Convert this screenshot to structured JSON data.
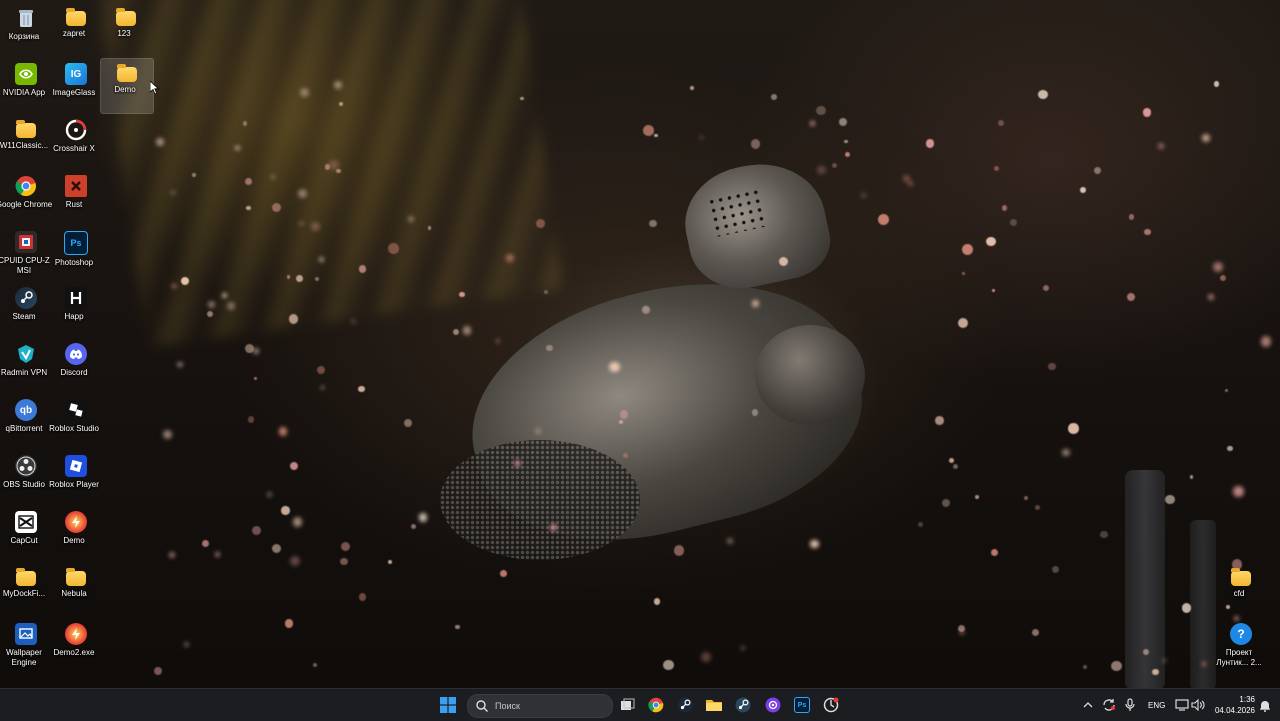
{
  "desktop": {
    "icons": [
      {
        "label": "Корзина",
        "icon": "recycle-bin-icon"
      },
      {
        "label": "zapret",
        "icon": "folder-icon"
      },
      {
        "label": "123",
        "icon": "folder-icon"
      },
      {
        "label": "NVIDIA App",
        "icon": "nvidia-icon"
      },
      {
        "label": "ImageGlass",
        "icon": "imageglass-icon"
      },
      {
        "label": "Demo",
        "icon": "folder-icon"
      },
      {
        "label": "W11Classic...",
        "icon": "folder-icon"
      },
      {
        "label": "Crosshair X",
        "icon": "crosshair-icon"
      },
      {
        "label": "Google Chrome",
        "icon": "chrome-icon"
      },
      {
        "label": "Rust",
        "icon": "rust-icon"
      },
      {
        "label": "CPUID CPU-Z MSI",
        "icon": "cpuz-icon"
      },
      {
        "label": "Photoshop",
        "icon": "photoshop-icon"
      },
      {
        "label": "Steam",
        "icon": "steam-icon"
      },
      {
        "label": "Happ",
        "icon": "happ-icon"
      },
      {
        "label": "Radmin VPN",
        "icon": "radmin-vpn-icon"
      },
      {
        "label": "Discord",
        "icon": "discord-icon"
      },
      {
        "label": "qBittorrent",
        "icon": "qbittorrent-icon"
      },
      {
        "label": "Roblox Studio",
        "icon": "roblox-studio-icon"
      },
      {
        "label": "OBS Studio",
        "icon": "obs-icon"
      },
      {
        "label": "Roblox Player",
        "icon": "roblox-player-icon"
      },
      {
        "label": "CapCut",
        "icon": "capcut-icon"
      },
      {
        "label": "Demo",
        "icon": "demo-app-icon"
      },
      {
        "label": "MyDockFi...",
        "icon": "folder-icon"
      },
      {
        "label": "Nebula",
        "icon": "folder-icon"
      },
      {
        "label": "Wallpaper Engine",
        "icon": "wallpaper-engine-icon"
      },
      {
        "label": "Demo2.exe",
        "icon": "demo2-exe-icon"
      },
      {
        "label": "cfd",
        "icon": "folder-icon"
      },
      {
        "label": "Проект Лунтик... 2...",
        "icon": "help-icon"
      }
    ]
  },
  "taskbar": {
    "search_placeholder": "Поиск",
    "apps": [
      "start",
      "search",
      "task-view",
      "chrome",
      "steam",
      "explorer",
      "steam",
      "nebula",
      "photoshop",
      "demo"
    ],
    "language": "ENG",
    "time": "1:36",
    "date": "04.04.2026"
  },
  "colors": {
    "taskbar_bg": "#1c1e22",
    "folder_yellow": "#f2b632",
    "accent_blue": "#0a84ff"
  }
}
